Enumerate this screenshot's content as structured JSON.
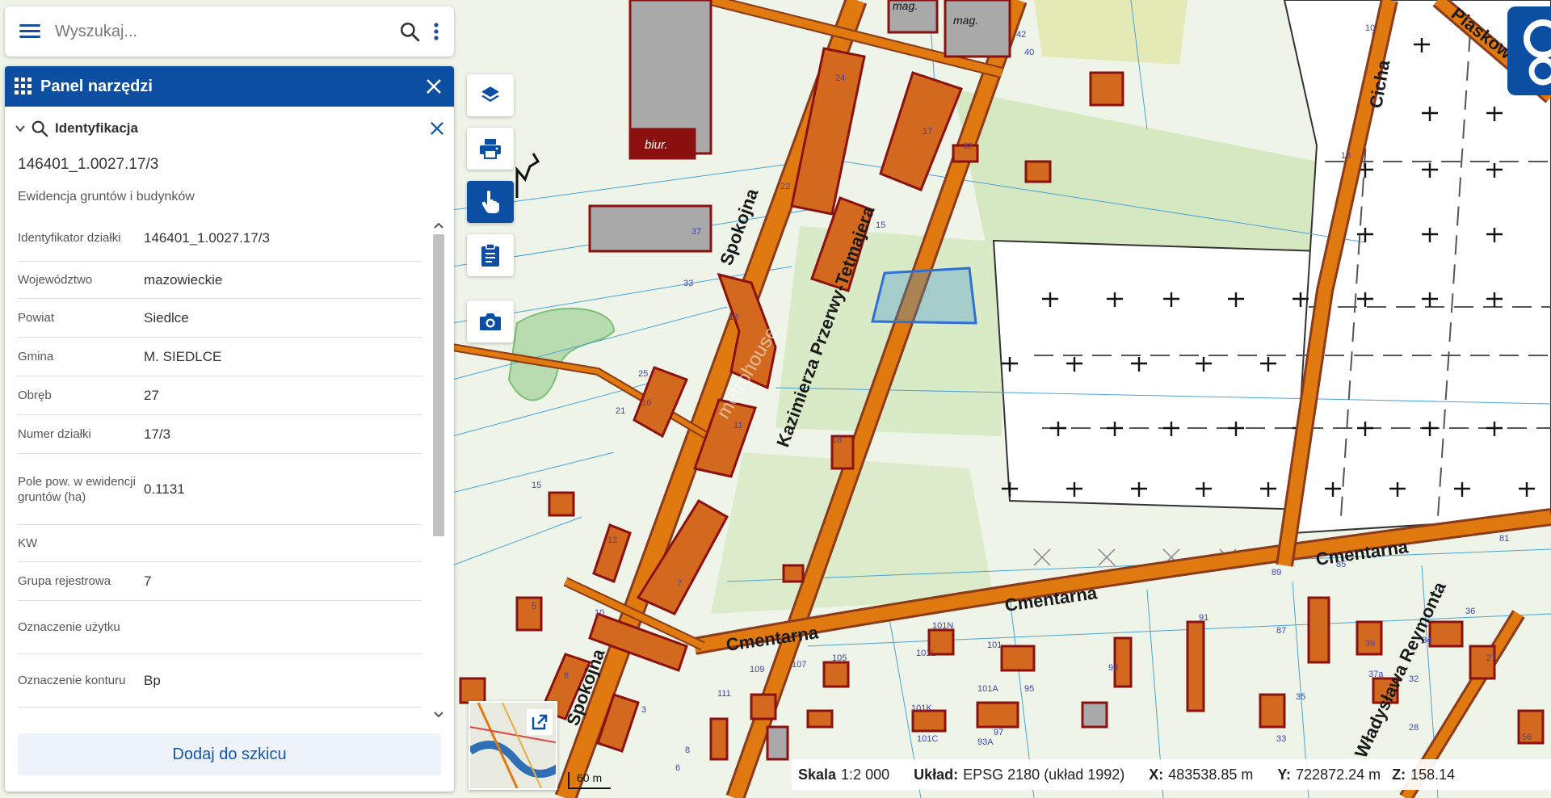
{
  "search": {
    "placeholder": "Wyszukaj..."
  },
  "panel": {
    "title": "Panel narzędzi",
    "section_label": "Identyfikacja",
    "plot_id": "146401_1.0027.17/3",
    "layer_name": "Ewidencja gruntów i budynków",
    "attributes": [
      {
        "key": "Identyfikator działki",
        "value": "146401_1.0027.17/3"
      },
      {
        "key": "Województwo",
        "value": "mazowieckie"
      },
      {
        "key": "Powiat",
        "value": "Siedlce"
      },
      {
        "key": "Gmina",
        "value": "M. SIEDLCE"
      },
      {
        "key": "Obręb",
        "value": "27"
      },
      {
        "key": "Numer działki",
        "value": "17/3"
      },
      {
        "key": "Pole pow. w ewidencji gruntów (ha)",
        "value": "0.1131"
      },
      {
        "key": "KW",
        "value": ""
      },
      {
        "key": "Grupa rejestrowa",
        "value": "7"
      },
      {
        "key": "Oznaczenie użytku",
        "value": ""
      },
      {
        "key": "Oznaczenie konturu",
        "value": "Bp"
      }
    ],
    "add_sketch_label": "Dodaj do szkicu"
  },
  "map_tools": [
    {
      "name": "layers-tool",
      "icon": "layers-icon"
    },
    {
      "name": "print-tool",
      "icon": "printer-icon"
    },
    {
      "name": "identify-tool",
      "icon": "pointer-hand-icon",
      "active": true
    },
    {
      "name": "clipboard-tool",
      "icon": "clipboard-icon"
    },
    {
      "name": "screenshot-tool",
      "icon": "camera-icon"
    }
  ],
  "map": {
    "streets": [
      "Spokojna",
      "Spokojna",
      "Kazimierza Przerwy-Tetmajera",
      "Cmentarna",
      "Cmentarna",
      "Cmentarna",
      "Cicha",
      "Piaskow",
      "Władysława Reymonta"
    ],
    "building_labels": [
      "mag.",
      "mag.",
      "biur."
    ],
    "house_numbers": [
      "10",
      "42",
      "40",
      "24",
      "17",
      "32",
      "18",
      "22",
      "15",
      "37",
      "33",
      "18",
      "25",
      "16",
      "21",
      "11",
      "18",
      "15",
      "12",
      "7",
      "5",
      "10",
      "8",
      "3",
      "111",
      "109",
      "107",
      "105",
      "101N",
      "101L",
      "101",
      "101A",
      "101K",
      "101C",
      "97",
      "93A",
      "95",
      "93",
      "91",
      "89",
      "87",
      "85",
      "81",
      "39",
      "36",
      "34",
      "35",
      "37a",
      "32",
      "27",
      "33",
      "28",
      "56",
      "6",
      "8"
    ],
    "watermark": "metrohouse"
  },
  "scale_bar": {
    "label": "60 m"
  },
  "status": {
    "scale_label": "Skala",
    "scale_value": "1:2 000",
    "crs_label": "Układ:",
    "crs_value": "EPSG 2180 (układ 1992)",
    "x_label": "X:",
    "x_value": "483538.85 m",
    "y_label": "Y:",
    "y_value": "722872.24 m",
    "z_label": "Z:",
    "z_value": "158.14"
  },
  "colors": {
    "brand_blue": "#0b4ea2",
    "road": "#e07a10",
    "building": "#d2691e",
    "building_outline": "#8b1010",
    "highlight_parcel": "#2f6fd6"
  }
}
